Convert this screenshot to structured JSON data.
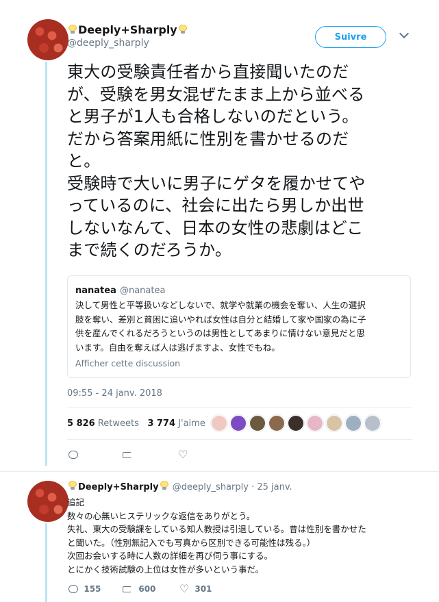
{
  "tweet": {
    "display_name": "Deeply+Sharply",
    "handle": "@deeply_sharply",
    "follow_label": "Suivre",
    "text": "東大の受験責任者から直接聞いたのだ\nが、受験を男女混ぜたまま上から並べる\nと男子が1人も合格しないのだという。\nだから答案用紙に性別を書かせるのだ\nと。\n受験時で大いに男子にゲタを履かせてや\nっているのに、社会に出たら男しか出世\nしないなんて、日本の女性の悲劇はどこ\nまで続くのだろうか。",
    "quote": {
      "name": "nanatea",
      "handle": "@nanatea",
      "text": "決して男性と平等扱いなどしないで、就学や就業の機会を奪い、人生の選択\n肢を奪い、差別と貧困に追いやれば女性は自分と結婚して家や国家の為に子\n供を産んでくれるだろうというのは男性としてあまりに情けない意見だと思\nいます。自由を奪えば人は逃げますよ、女性でもね。",
      "link": "Afficher cette discussion"
    },
    "timestamp": "09:55 - 24 janv. 2018",
    "retweets_count": "5 826",
    "retweets_label": "Retweets",
    "likes_count": "3 774",
    "likes_label": "J'aime"
  },
  "reply": {
    "display_name": "Deeply+Sharply",
    "handle": "@deeply_sharply",
    "date": "· 25 janv.",
    "text": "追記\n数々の心無いヒステリックな返信をありがとう。\n失礼、東大の受験課をしている知人教授は引退している。昔は性別を書かせた\nと聞いた。（性別無記入でも写真から区別できる可能性は残る。）\n次回お会いする時に人数の詳細を再び伺う事にする。\nとにかく技術試験の上位は女性が多いという事だ。",
    "reply_count": "155",
    "retweet_count": "600",
    "like_count": "301"
  },
  "colors": {
    "accent": "#1da1f2",
    "muted": "#657786",
    "thread_line": "#bfe3f5"
  },
  "liker_faces": [
    "#f0c9c0",
    "#7d4bc4",
    "#6b5a3e",
    "#8a6a4a",
    "#3a2f2a",
    "#e8b7c6",
    "#d8c3a5",
    "#9db0c0",
    "#b7c0c8"
  ]
}
